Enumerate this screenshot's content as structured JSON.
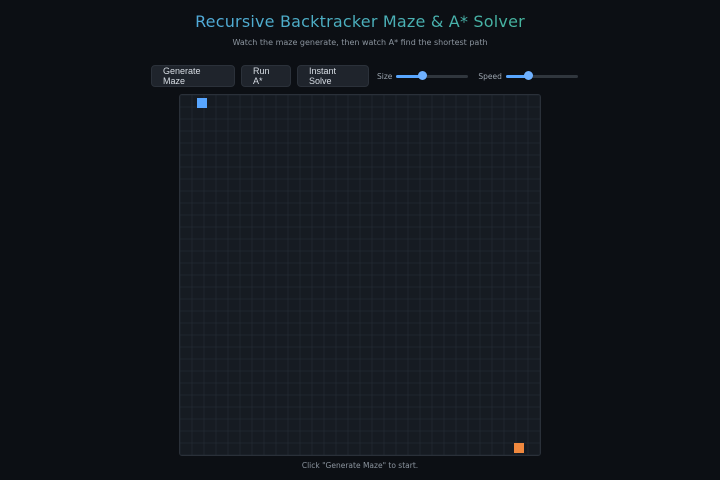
{
  "header": {
    "title": "Recursive Backtracker Maze & A* Solver",
    "subtitle": "Watch the maze generate, then watch A* find the shortest path"
  },
  "controls": {
    "generate_label": "Generate Maze",
    "run_label": "Run A*",
    "instant_label": "Instant Solve",
    "size_label": "Size",
    "speed_label": "Speed",
    "size_value": 0.35,
    "speed_value": 0.3,
    "accent_color": "#58a6ff"
  },
  "maze": {
    "grid_cells": 30,
    "start_color": "#58a6ff",
    "end_color": "#f0883e"
  },
  "status": {
    "text": "Click \"Generate Maze\" to start."
  }
}
